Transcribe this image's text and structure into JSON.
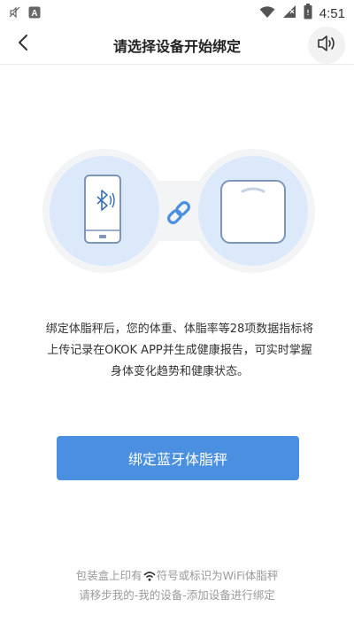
{
  "status_bar": {
    "time": "4:51",
    "icons": [
      "mute-icon",
      "notification-a-icon",
      "wifi-icon",
      "signal-icon",
      "battery-icon"
    ]
  },
  "header": {
    "title": "请选择设备开始绑定",
    "back_icon": "chevron-left-icon",
    "sound_icon": "speaker-icon"
  },
  "illustration": {
    "left_icon": "phone-bluetooth-icon",
    "link_icon": "link-icon",
    "right_icon": "scale-icon"
  },
  "description": "绑定体脂秤后，您的体重、体脂率等28项数据指标将上传记录在OKOK APP并生成健康报告，可实时掌握身体变化趋势和健康状态。",
  "bind_button_label": "绑定蓝牙体脂秤",
  "note": {
    "line1_before": "包装盒上印有",
    "line1_after": "符号或标识为WiFi体脂秤",
    "line2": "请移步我的-我的设备-添加设备进行绑定"
  },
  "colors": {
    "accent": "#4a8fe0",
    "circle_bg": "#dbe9fb",
    "note_text": "#9a9a9a"
  }
}
